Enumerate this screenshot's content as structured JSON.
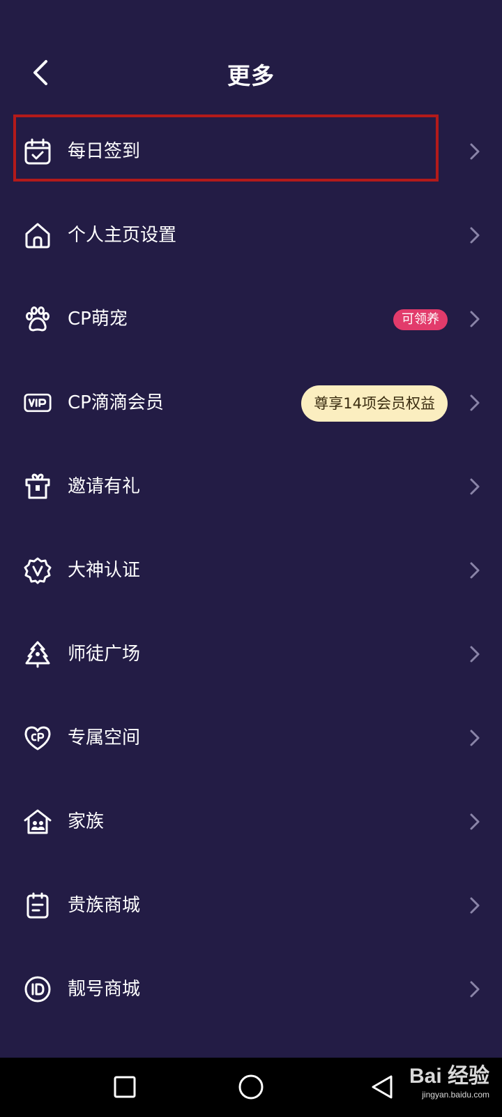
{
  "header": {
    "title": "更多",
    "back_icon": "back-arrow-icon"
  },
  "menu": {
    "items": [
      {
        "label": "每日签到",
        "icon": "calendar-check-icon",
        "highlighted": true
      },
      {
        "label": "个人主页设置",
        "icon": "home-icon"
      },
      {
        "label": "CP萌宠",
        "icon": "paw-icon",
        "badge": "可领养"
      },
      {
        "label": "CP滴滴会员",
        "icon": "vip-icon",
        "badge": "尊享14项会员权益"
      },
      {
        "label": "邀请有礼",
        "icon": "gift-icon"
      },
      {
        "label": "大神认证",
        "icon": "verified-badge-icon"
      },
      {
        "label": "师徒广场",
        "icon": "tree-icon"
      },
      {
        "label": "专属空间",
        "icon": "cp-heart-icon"
      },
      {
        "label": "家族",
        "icon": "family-house-icon"
      },
      {
        "label": "贵族商城",
        "icon": "clipboard-icon"
      },
      {
        "label": "靓号商城",
        "icon": "id-icon"
      }
    ]
  },
  "nav": {
    "recents_icon": "square-icon",
    "home_icon": "circle-icon",
    "back_icon": "triangle-back-icon"
  },
  "watermark": {
    "main": "Bai 经验",
    "sub": "jingyan.baidu.com"
  },
  "colors": {
    "background": "#231c45",
    "highlight_border": "#b31a1a",
    "pink_badge": "#e23b6b",
    "yellow_badge": "#fbeec0",
    "chevron": "#8a84a8"
  }
}
